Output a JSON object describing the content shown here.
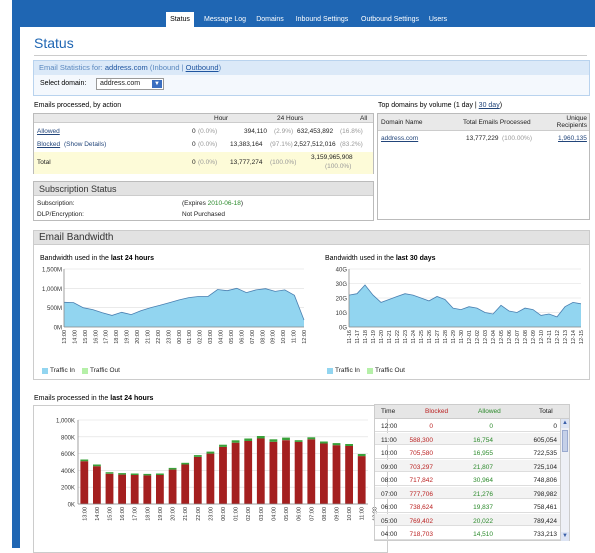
{
  "tabs": [
    {
      "label": "Status",
      "active": true
    },
    {
      "label": "Message Log"
    },
    {
      "label": "Domains"
    },
    {
      "label": "Inbound Settings"
    },
    {
      "label": "Outbound Settings"
    },
    {
      "label": "Users"
    }
  ],
  "page_title": "Status",
  "email_stats": {
    "prefix": "Email Statistics for:",
    "domain": "address.com",
    "inbound": "(Inbound |",
    "outbound": "Outbound",
    "close": ")"
  },
  "domain_select": {
    "label": "Select domain:",
    "value": "address.com"
  },
  "processed_by_action": {
    "title": "Emails processed, by action",
    "headers": [
      "Hour",
      "24 Hours",
      "All"
    ],
    "rows": [
      {
        "label": "Allowed",
        "extra": "",
        "hour": "0",
        "hour_pct": "(0.0%)",
        "day": "394,110",
        "day_pct": "(2.9%)",
        "all": "632,453,892",
        "all_pct": "(16.8%)"
      },
      {
        "label": "Blocked",
        "extra": "(Show Details)",
        "hour": "0",
        "hour_pct": "(0.0%)",
        "day": "13,383,164",
        "day_pct": "(97.1%)",
        "all": "2,527,512,016",
        "all_pct": "(83.2%)"
      },
      {
        "label": "Total",
        "extra": "",
        "hour": "0",
        "hour_pct": "(0.0%)",
        "day": "13,777,274",
        "day_pct": "(100.0%)",
        "all": "3,159,965,908",
        "all_pct": "(100.0%)"
      }
    ]
  },
  "top_domains": {
    "title_prefix": "Top domains by volume (",
    "day": "1 day",
    "sep": " | ",
    "month": "30 day",
    "close": ")",
    "headers": [
      "Domain Name",
      "Total Emails Processed",
      "Unique Recipients"
    ],
    "rows": [
      {
        "domain": "address.com",
        "total": "13,777,229",
        "pct": "(100.00%)",
        "unique": "1,960,135"
      }
    ]
  },
  "subscription": {
    "title": "Subscription Status",
    "rows": [
      {
        "label": "Subscription:",
        "value_prefix": "(Expires ",
        "value_date": "2010-06-18",
        "value_suffix": ")"
      },
      {
        "label": "DLP/Encryption:",
        "value": "Not Purchased"
      }
    ]
  },
  "bandwidth": {
    "title": "Email Bandwidth",
    "left_label_prefix": "Bandwidth used in the ",
    "left_label_bold": "last 24 hours",
    "right_label_prefix": "Bandwidth used in the ",
    "right_label_bold": "last 30 days",
    "legend": {
      "in": "Traffic In",
      "out": "Traffic Out"
    },
    "colors": {
      "in": "#92d5f0",
      "out": "#b5f0a8",
      "line": "#4a7fb0"
    }
  },
  "processed_24h_label": {
    "prefix": "Emails processed in the ",
    "bold": "last 24 hours"
  },
  "chart_data": [
    {
      "type": "area",
      "title": "Bandwidth used in the last 24 hours",
      "ylim": [
        0,
        1500
      ],
      "yticks": [
        "0M",
        "500M",
        "1,000M",
        "1,500M"
      ],
      "x": [
        "13:00",
        "14:00",
        "15:00",
        "16:00",
        "17:00",
        "18:00",
        "19:00",
        "20:00",
        "21:00",
        "22:00",
        "23:00",
        "00:00",
        "01:00",
        "02:00",
        "03:00",
        "04:00",
        "05:00",
        "06:00",
        "07:00",
        "08:00",
        "09:00",
        "10:00",
        "11:00",
        "12:00"
      ],
      "series": [
        {
          "name": "Traffic In",
          "values": [
            640,
            630,
            500,
            450,
            370,
            300,
            380,
            320,
            420,
            500,
            560,
            630,
            700,
            760,
            790,
            790,
            970,
            940,
            1000,
            890,
            960,
            990,
            920,
            960,
            820,
            180
          ]
        }
      ],
      "x_points": 26
    },
    {
      "type": "area",
      "title": "Bandwidth used in the last 30 days",
      "ylim": [
        0,
        40
      ],
      "yticks": [
        "0G",
        "10G",
        "20G",
        "30G",
        "40G"
      ],
      "x": [
        "11-16",
        "11-17",
        "11-18",
        "11-19",
        "11-20",
        "11-21",
        "11-22",
        "11-23",
        "11-24",
        "11-25",
        "11-26",
        "11-27",
        "11-28",
        "11-29",
        "11-30",
        "12-01",
        "12-02",
        "12-03",
        "12-04",
        "12-05",
        "12-06",
        "12-07",
        "12-08",
        "12-09",
        "12-10",
        "12-11",
        "12-12",
        "12-13",
        "12-14",
        "12-15"
      ],
      "series": [
        {
          "name": "Traffic In",
          "values": [
            22,
            23,
            29,
            22,
            17,
            19,
            21,
            23,
            22,
            20,
            18,
            21,
            19,
            13,
            12,
            14,
            13,
            10,
            9,
            15,
            11,
            10,
            13,
            12,
            8,
            9,
            7,
            14,
            17,
            16
          ]
        }
      ]
    },
    {
      "type": "bar",
      "title": "Emails processed in the last 24 hours",
      "ylim": [
        0,
        1000
      ],
      "yticks": [
        "0K",
        "200K",
        "400K",
        "600K",
        "800K",
        "1,000K"
      ],
      "categories": [
        "13:00",
        "14:00",
        "15:00",
        "16:00",
        "17:00",
        "18:00",
        "19:00",
        "20:00",
        "21:00",
        "22:00",
        "23:00",
        "00:00",
        "01:00",
        "02:00",
        "03:00",
        "04:00",
        "05:00",
        "06:00",
        "07:00",
        "08:00",
        "09:00",
        "10:00",
        "11:00",
        "12:00"
      ],
      "series": [
        {
          "name": "Blocked",
          "color": "#a41f1f",
          "values": [
            510,
            450,
            360,
            350,
            345,
            340,
            345,
            410,
            470,
            560,
            600,
            680,
            730,
            750,
            780,
            740,
            760,
            740,
            770,
            720,
            700,
            690,
            570
          ]
        },
        {
          "name": "Allowed",
          "color": "#3aa13a",
          "values": [
            20,
            20,
            18,
            18,
            18,
            18,
            18,
            20,
            20,
            22,
            24,
            26,
            28,
            30,
            30,
            30,
            30,
            20,
            24,
            24,
            25,
            24,
            25
          ]
        }
      ]
    }
  ],
  "time_table": {
    "headers": [
      "Time",
      "Blocked",
      "Allowed",
      "Total"
    ],
    "rows": [
      {
        "time": "12:00",
        "blocked": "0",
        "allowed": "0",
        "total": "0"
      },
      {
        "time": "11:00",
        "blocked": "588,300",
        "allowed": "16,754",
        "total": "605,054"
      },
      {
        "time": "10:00",
        "blocked": "705,580",
        "allowed": "16,955",
        "total": "722,535"
      },
      {
        "time": "09:00",
        "blocked": "703,297",
        "allowed": "21,807",
        "total": "725,104"
      },
      {
        "time": "08:00",
        "blocked": "717,842",
        "allowed": "30,964",
        "total": "748,806"
      },
      {
        "time": "07:00",
        "blocked": "777,706",
        "allowed": "21,276",
        "total": "798,982"
      },
      {
        "time": "06:00",
        "blocked": "738,624",
        "allowed": "19,837",
        "total": "758,461"
      },
      {
        "time": "05:00",
        "blocked": "769,402",
        "allowed": "20,022",
        "total": "789,424"
      },
      {
        "time": "04:00",
        "blocked": "718,703",
        "allowed": "14,510",
        "total": "733,213"
      }
    ]
  }
}
